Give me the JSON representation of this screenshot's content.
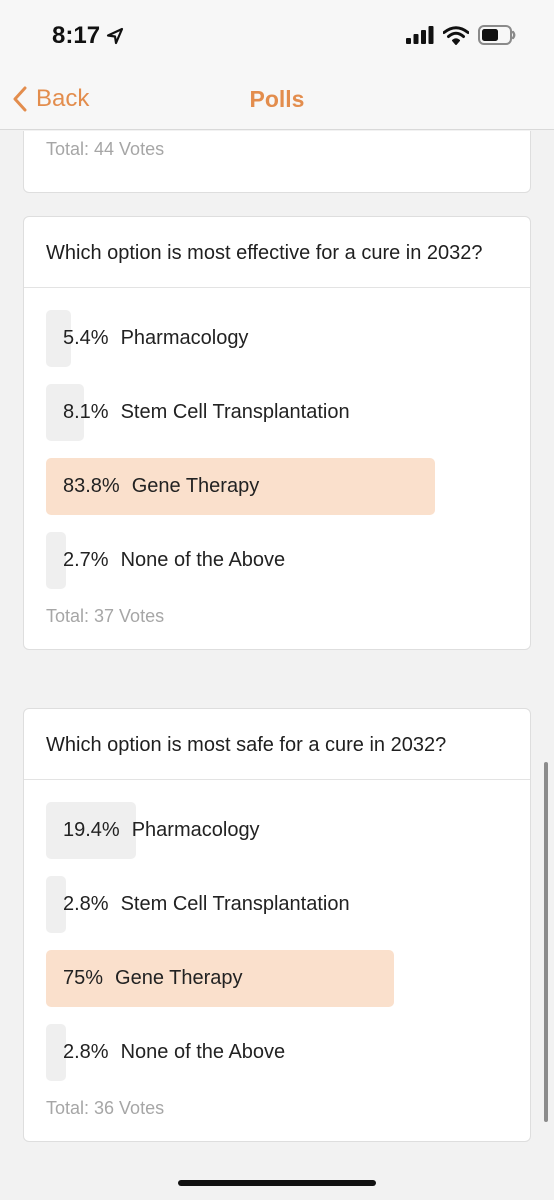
{
  "status_bar": {
    "time": "8:17",
    "icons": [
      "location-arrow-icon",
      "cellular-signal-icon",
      "wifi-icon",
      "battery-icon"
    ]
  },
  "nav": {
    "back_label": "Back",
    "title": "Polls",
    "accent_color": "#e38d4d"
  },
  "previous_poll": {
    "total": "Total: 44 Votes"
  },
  "polls": [
    {
      "question": "Which option is most effective for a cure in 2032?",
      "options": [
        {
          "percent": "5.4%",
          "label": "Pharmacology",
          "fraction": 0.054
        },
        {
          "percent": "8.1%",
          "label": "Stem Cell Transplantation",
          "fraction": 0.081
        },
        {
          "percent": "83.8%",
          "label": "Gene Therapy",
          "fraction": 0.838
        },
        {
          "percent": "2.7%",
          "label": "None of the Above",
          "fraction": 0.027
        }
      ],
      "total": "Total: 37 Votes"
    },
    {
      "question": "Which option is most safe for a cure in 2032?",
      "options": [
        {
          "percent": "19.4%",
          "label": "Pharmacology",
          "fraction": 0.194
        },
        {
          "percent": "2.8%",
          "label": "Stem Cell Transplantation",
          "fraction": 0.028
        },
        {
          "percent": "75%",
          "label": "Gene Therapy",
          "fraction": 0.75
        },
        {
          "percent": "2.8%",
          "label": "None of the Above",
          "fraction": 0.028
        }
      ],
      "total": "Total: 36 Votes"
    }
  ],
  "colors": {
    "bar_default": "#efefef",
    "bar_leading": "#fae0cc"
  }
}
